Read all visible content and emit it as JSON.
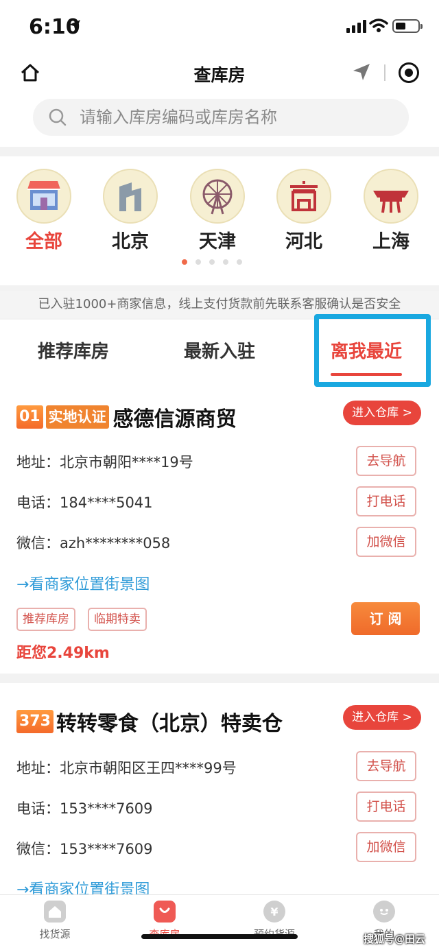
{
  "status_bar": {
    "time": "6:10"
  },
  "nav": {
    "title": "查库房"
  },
  "search": {
    "placeholder": "请输入库房编码或库房名称"
  },
  "categories": [
    {
      "label": "全部",
      "icon": "store-icon",
      "active": true
    },
    {
      "label": "北京",
      "icon": "beijing-cctv-icon",
      "active": false
    },
    {
      "label": "天津",
      "icon": "ferris-wheel-icon",
      "active": false
    },
    {
      "label": "河北",
      "icon": "hebei-gate-icon",
      "active": false
    },
    {
      "label": "上海",
      "icon": "shanghai-pavilion-icon",
      "active": false
    }
  ],
  "notice": "已入驻1000+商家信息，线上支付货款前先联系客服确认是否安全",
  "tabs": [
    {
      "label": "推荐库房",
      "active": false
    },
    {
      "label": "最新入驻",
      "active": false
    },
    {
      "label": "离我最近",
      "active": true
    }
  ],
  "stores": [
    {
      "rank": "01",
      "verified_label": "实地认证",
      "name": "感德信源商贸",
      "enter_label": "进入仓库 >",
      "address": "地址：北京市朝阳****19号",
      "phone": "电话：184****5041",
      "wechat": "微信：azh********058",
      "nav_label": "去导航",
      "call_label": "打电话",
      "wechat_label": "加微信",
      "streetview_label": "→看商家位置街景图",
      "tags": [
        "推荐库房",
        "临期特卖"
      ],
      "subscribe_label": "订 阅",
      "distance": "距您2.49km"
    },
    {
      "rank": "373",
      "name": "转转零食（北京）特卖仓",
      "enter_label": "进入仓库 >",
      "address": "地址：北京市朝阳区王四****99号",
      "phone": "电话：153****7609",
      "wechat": "微信：153****7609",
      "nav_label": "去导航",
      "call_label": "打电话",
      "wechat_label": "加微信",
      "streetview_label": "→看商家位置街景图"
    }
  ],
  "tab_bar": [
    {
      "label": "找货源",
      "icon": "home-icon",
      "active": false
    },
    {
      "label": "查库房",
      "icon": "bag-icon",
      "active": true
    },
    {
      "label": "预约货源",
      "icon": "yuan-icon",
      "active": false
    },
    {
      "label": "我的",
      "icon": "profile-icon",
      "active": false
    }
  ],
  "watermark": "搜狐号@田云",
  "colors": {
    "accent": "#e8453c",
    "highlight": "#19a8e0",
    "link": "#2f9bd8"
  }
}
